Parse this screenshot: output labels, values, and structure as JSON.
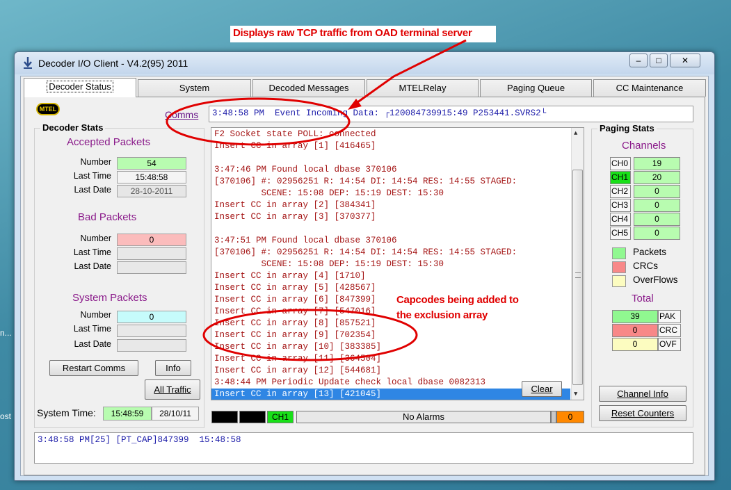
{
  "desktop": {
    "text_1": "n...",
    "text_2": "ost"
  },
  "annotations": {
    "top": "Displays raw TCP traffic from OAD terminal server",
    "middle": "Capcodes being added to the exclusion array"
  },
  "window": {
    "title": "Decoder I/O Client - V4.2(95)  2011",
    "controls": {
      "minimize": "–",
      "maximize": "□",
      "close": "✕"
    }
  },
  "tabs": [
    {
      "label": "Decoder Status",
      "active": true
    },
    {
      "label": "System"
    },
    {
      "label": "Decoded Messages"
    },
    {
      "label": "MTELRelay"
    },
    {
      "label": "Paging Queue"
    },
    {
      "label": "CC Maintenance"
    }
  ],
  "logo": "MTEL",
  "comms": {
    "link_label": "Comms",
    "line": "3:48:58 PM  Event Incoming Data: ┌120084739915:49 P253441.SVRS2└"
  },
  "decoder_stats": {
    "title": "Decoder Stats",
    "accepted": {
      "title": "Accepted Packets",
      "number_label": "Number",
      "number": "54",
      "last_time_label": "Last Time",
      "last_time": "15:48:58",
      "last_date_label": "Last Date",
      "last_date": "28-10-2011"
    },
    "bad": {
      "title": "Bad Packets",
      "number_label": "Number",
      "number": "0",
      "last_time_label": "Last Time",
      "last_time": "",
      "last_date_label": "Last Date",
      "last_date": ""
    },
    "system": {
      "title": "System Packets",
      "number_label": "Number",
      "number": "0",
      "last_time_label": "Last Time",
      "last_time": "",
      "last_date_label": "Last Date",
      "last_date": ""
    }
  },
  "buttons": {
    "restart": "Restart Comms",
    "info": "Info",
    "all_traffic": "All Traffic",
    "clear": "Clear",
    "channel_info": "Channel Info",
    "reset": "Reset Counters"
  },
  "system_time": {
    "label": "System Time:",
    "time": "15:48:59",
    "date": "28/10/11"
  },
  "log": [
    "F2 Socket state POLL: connected",
    "Insert CC in array [1] [416465]",
    "",
    "3:47:46 PM Found local dbase 370106",
    "[370106] #: 02956251 R: 14:54 DI: 14:54 RES: 14:55 STAGED:",
    "         SCENE: 15:08 DEP: 15:19 DEST: 15:30",
    "Insert CC in array [2] [384341]",
    "Insert CC in array [3] [370377]",
    "",
    "3:47:51 PM Found local dbase 370106",
    "[370106] #: 02956251 R: 14:54 DI: 14:54 RES: 14:55 STAGED:",
    "         SCENE: 15:08 DEP: 15:19 DEST: 15:30",
    "Insert CC in array [4] [1710]",
    "Insert CC in array [5] [428567]",
    "Insert CC in array [6] [847399]",
    "Insert CC in array [7] [547016]",
    "Insert CC in array [8] [857521]",
    "Insert CC in array [9] [702354]",
    "Insert CC in array [10] [383385]",
    "Insert CC in array [11] [364504]",
    "Insert CC in array [12] [544681]",
    "3:48:44 PM Periodic Update check local dbase 0082313",
    "Insert CC in array [13] [421045]"
  ],
  "status_bar": {
    "channel": "CH1",
    "alarms": "No Alarms",
    "count": "0"
  },
  "paging_stats": {
    "title": "Paging Stats",
    "channels_title": "Channels",
    "channels": [
      {
        "label": "CH0",
        "value": "19",
        "active": false
      },
      {
        "label": "CH1",
        "value": "20",
        "active": true
      },
      {
        "label": "CH2",
        "value": "0",
        "active": false
      },
      {
        "label": "CH3",
        "value": "0",
        "active": false
      },
      {
        "label": "CH4",
        "value": "0",
        "active": false
      },
      {
        "label": "CH5",
        "value": "0",
        "active": false
      }
    ],
    "legend": [
      {
        "label": "Packets",
        "color": "#90f890"
      },
      {
        "label": "CRCs",
        "color": "#f88888"
      },
      {
        "label": "OverFlows",
        "color": "#fcfcc0"
      }
    ],
    "total_title": "Total",
    "totals": [
      {
        "label": "PAK",
        "value": "39",
        "color": "#90f890"
      },
      {
        "label": "CRC",
        "value": "0",
        "color": "#f88888"
      },
      {
        "label": "OVF",
        "value": "0",
        "color": "#fcfcc0"
      }
    ]
  },
  "bottom_line": "3:48:58 PM[25] [PT_CAP]847399  15:48:58"
}
